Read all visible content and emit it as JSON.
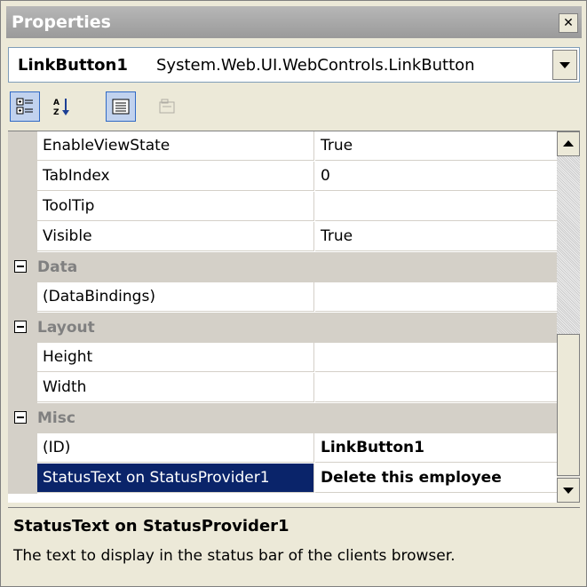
{
  "window": {
    "title": "Properties"
  },
  "object_selector": {
    "name": "LinkButton1",
    "type": "System.Web.UI.WebControls.LinkButton"
  },
  "toolbar": {
    "buttons": [
      {
        "icon": "categorized-icon",
        "pressed": true
      },
      {
        "icon": "alphabetical-icon",
        "pressed": false
      },
      {
        "icon": "properties-icon",
        "pressed": true
      },
      {
        "icon": "property-pages-icon",
        "disabled": true
      }
    ]
  },
  "grid": {
    "rows": [
      {
        "kind": "prop",
        "name": "EnableViewState",
        "value": "True"
      },
      {
        "kind": "prop",
        "name": "TabIndex",
        "value": "0"
      },
      {
        "kind": "prop",
        "name": "ToolTip",
        "value": ""
      },
      {
        "kind": "prop",
        "name": "Visible",
        "value": "True"
      },
      {
        "kind": "category",
        "name": "Data"
      },
      {
        "kind": "prop",
        "name": "(DataBindings)",
        "value": ""
      },
      {
        "kind": "category",
        "name": "Layout"
      },
      {
        "kind": "prop",
        "name": "Height",
        "value": ""
      },
      {
        "kind": "prop",
        "name": "Width",
        "value": ""
      },
      {
        "kind": "category",
        "name": "Misc"
      },
      {
        "kind": "prop",
        "name": "(ID)",
        "value": "LinkButton1",
        "bold": true
      },
      {
        "kind": "prop",
        "name": "StatusText on StatusProvider1",
        "value": "Delete this employee",
        "bold": true,
        "selected": true
      }
    ]
  },
  "description": {
    "title": "StatusText on StatusProvider1",
    "text": "The text to display in the status bar of the clients browser."
  },
  "colors": {
    "selection": "#0a246a",
    "chrome": "#ece9d8",
    "category": "#d4d0c8"
  }
}
